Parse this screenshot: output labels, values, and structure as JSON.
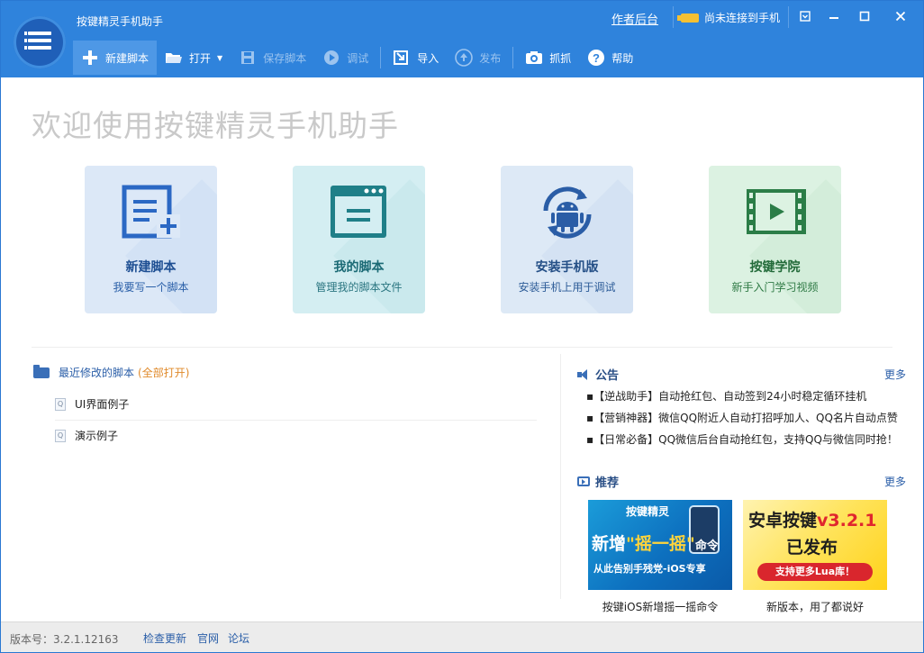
{
  "titlebar": {
    "app_title": "按键精灵手机助手",
    "backend_link": "作者后台",
    "phone_status": "尚未连接到手机"
  },
  "toolbar": {
    "items": [
      {
        "label": "新建脚本",
        "icon": "plus-icon",
        "state": "active"
      },
      {
        "label": "打开",
        "icon": "folder-open-icon",
        "state": "normal",
        "dropdown": true
      },
      {
        "label": "保存脚本",
        "icon": "save-icon",
        "state": "disabled"
      },
      {
        "label": "调试",
        "icon": "play-icon",
        "state": "disabled"
      },
      {
        "label": "导入",
        "icon": "import-icon",
        "state": "normal"
      },
      {
        "label": "发布",
        "icon": "publish-icon",
        "state": "disabled"
      },
      {
        "label": "抓抓",
        "icon": "camera-icon",
        "state": "normal"
      },
      {
        "label": "帮助",
        "icon": "help-icon",
        "state": "normal"
      }
    ]
  },
  "welcome": "欢迎使用按键精灵手机助手",
  "tiles": [
    {
      "title": "新建脚本",
      "subtitle": "我要写一个脚本",
      "icon": "new-script-icon"
    },
    {
      "title": "我的脚本",
      "subtitle": "管理我的脚本文件",
      "icon": "my-scripts-icon"
    },
    {
      "title": "安装手机版",
      "subtitle": "安装手机上用于调试",
      "icon": "android-sync-icon"
    },
    {
      "title": "按键学院",
      "subtitle": "新手入门学习视频",
      "icon": "video-film-icon"
    }
  ],
  "recent": {
    "title": "最近修改的脚本",
    "open_all": "(全部打开)",
    "items": [
      "UI界面例子",
      "演示例子"
    ]
  },
  "notice": {
    "title": "公告",
    "more": "更多",
    "items": [
      "【逆战助手】自动抢红包、自动签到24小时稳定循环挂机",
      "【营销神器】微信QQ附近人自动打招呼加人、QQ名片自动点赞",
      "【日常必备】QQ微信后台自动抢红包，支持QQ与微信同时抢！"
    ]
  },
  "recommend": {
    "title": "推荐",
    "more": "更多",
    "items": [
      {
        "caption": "按键iOS新增摇一摇命令",
        "banner_top": "按键精灵",
        "banner_mid_a": "新增",
        "banner_mid_b": "\"摇一摇\"",
        "banner_mid_c": "命令",
        "banner_bot": "从此告别手残党-iOS专享"
      },
      {
        "caption": "新版本，用了都说好",
        "banner_top_a": "安卓按键",
        "banner_top_b": "v3.2.1",
        "banner_mid": "已发布",
        "banner_bot": "支持更多Lua库！"
      }
    ]
  },
  "status": {
    "version": "版本号：3.2.1.12163",
    "links": [
      "检查更新",
      "官网",
      "论坛"
    ]
  },
  "colors": {
    "titlebar": "#2f83dc",
    "accent_link": "#2a5ea8",
    "open_all": "#e08a2b"
  }
}
